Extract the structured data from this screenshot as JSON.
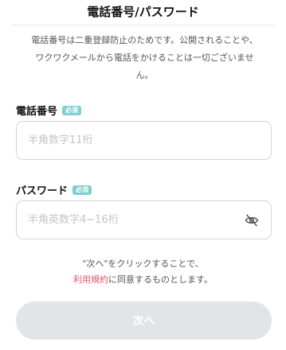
{
  "header": {
    "title": "電話番号/パスワード"
  },
  "notice": {
    "lines": [
      "電話番号は二重登録防止のためです。公開されることや、",
      "ワクワクメールから電話をかけることは一切ございませ",
      "ん。"
    ]
  },
  "phone": {
    "label": "電話番号",
    "badge": "必須",
    "placeholder": "半角数字11桁",
    "value": ""
  },
  "password": {
    "label": "パスワード",
    "badge": "必須",
    "placeholder": "半角英数字4~16桁",
    "value": "",
    "toggle_icon": "eye-slash-icon"
  },
  "terms": {
    "line1": "\"次へ\"をクリックすることで、",
    "link_text": "利用規約",
    "line2_suffix": "に同意するものとします。",
    "link_color": "#e4546e"
  },
  "next_button": {
    "label": "次へ",
    "state": "disabled"
  },
  "colors": {
    "badge": "#7ccfcf",
    "button_disabled": "#e2e4e8"
  }
}
